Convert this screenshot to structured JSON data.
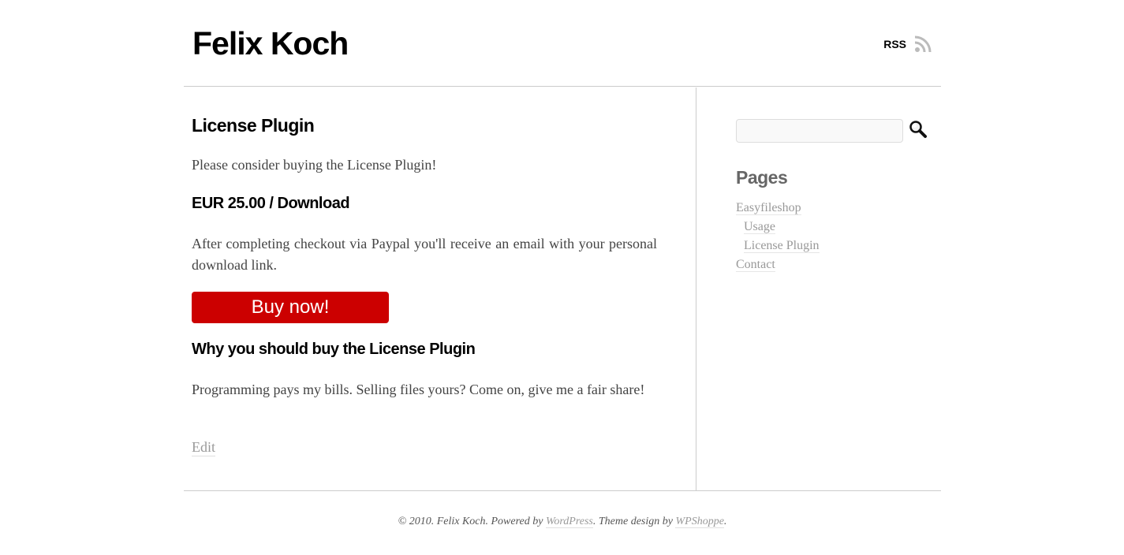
{
  "header": {
    "site_title": "Felix Koch",
    "rss_label": "RSS",
    "rss_icon": "rss-icon"
  },
  "post": {
    "title": "License Plugin",
    "intro": "Please consider buying the License Plugin!",
    "price": "EUR 25.00 / Download",
    "checkout_text": "After completing checkout via Paypal you'll receive an email with your personal download link.",
    "buy_button": "Buy now!",
    "why_title": "Why you should buy the License Plugin",
    "why_text": "Programming pays my bills. Selling files yours? Come on, give me a fair share!",
    "edit_link": "Edit",
    "accent_color": "#cc0000"
  },
  "sidebar": {
    "search": {
      "placeholder": "",
      "value": "",
      "icon": "search-icon"
    },
    "pages_title": "Pages",
    "pages": [
      {
        "label": "Easyfileshop",
        "level": 0
      },
      {
        "label": "Usage",
        "level": 1
      },
      {
        "label": "License Plugin",
        "level": 1
      },
      {
        "label": "Contact",
        "level": 0
      }
    ]
  },
  "footer": {
    "prefix": "© 2010. Felix Koch. Powered by ",
    "wordpress_link": "WordPress",
    "middle": ". Theme design by ",
    "wpshoppe_link": "WPShoppe",
    "suffix": "."
  }
}
